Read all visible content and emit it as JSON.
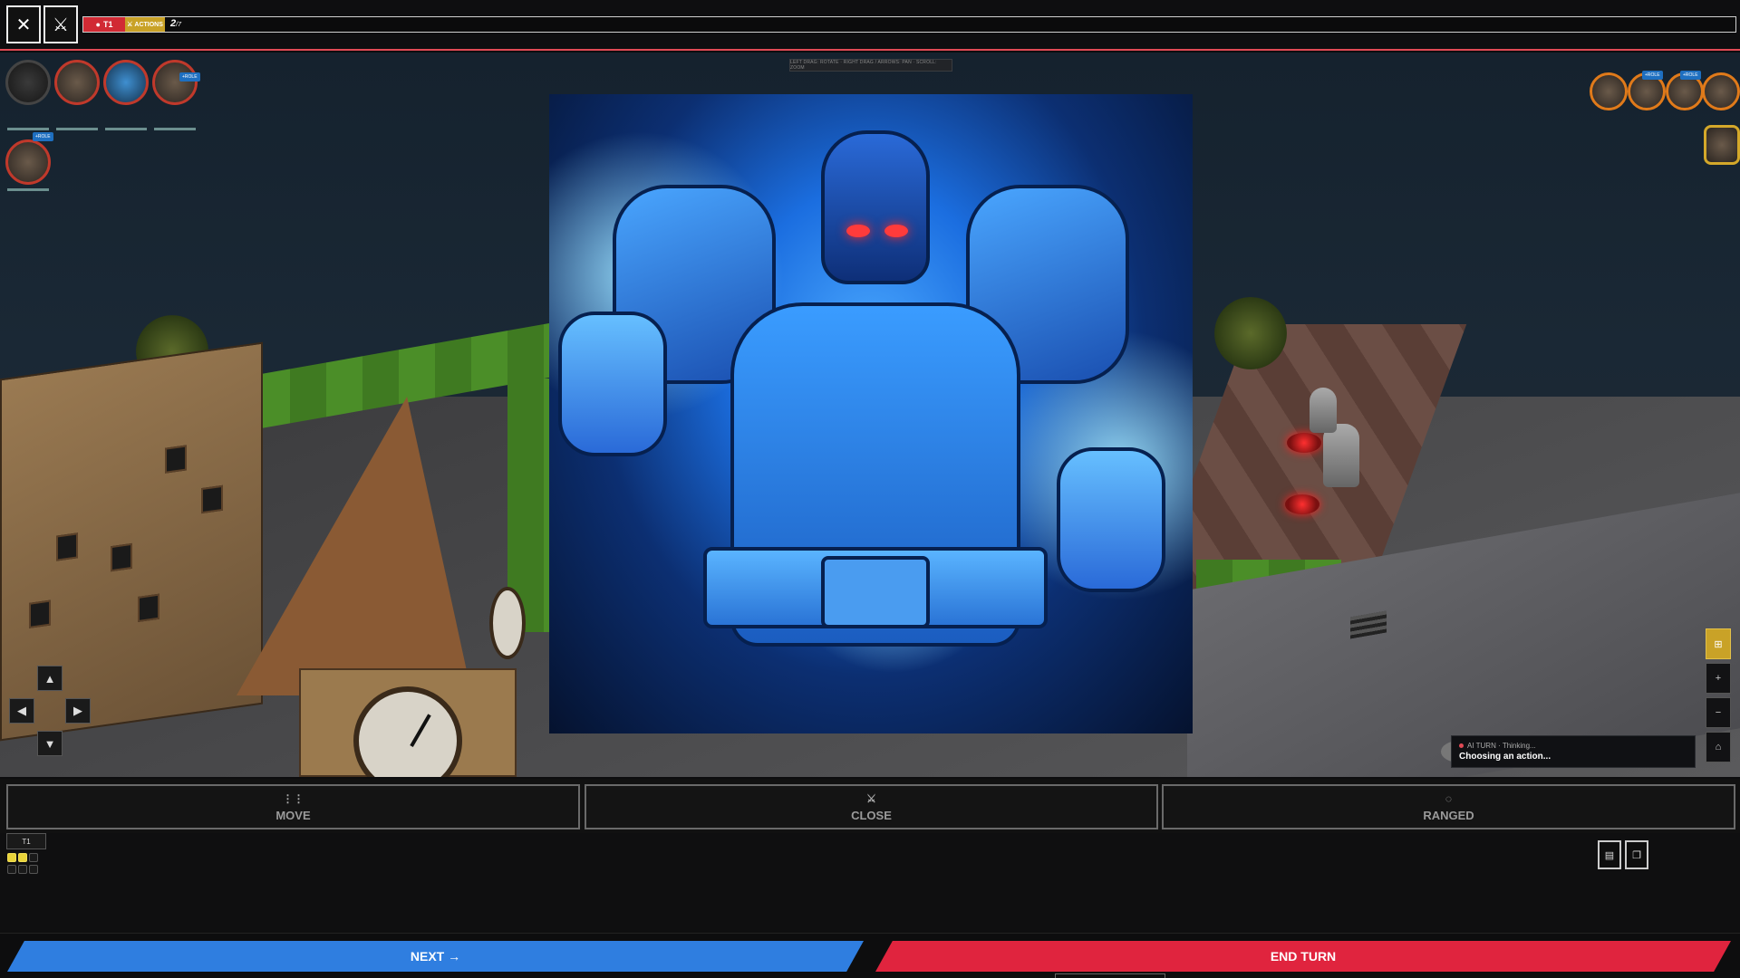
{
  "topbar": {
    "close_icon": "close-icon",
    "swords_icon": "swords-icon",
    "team_label": "T1",
    "actions_label": "ACTIONS",
    "round_number": "2",
    "round_total": "/7",
    "accent_color": "#e04a55"
  },
  "hint": "LEFT DRAG: ROTATE · RIGHT DRAG / ARROWS: PAN · SCROLL: ZOOM",
  "tokens": {
    "tag_label": "+ROLE"
  },
  "card": {
    "subject": "blue armored mech hero"
  },
  "camera_nav": {
    "up": "▲",
    "left": "◀",
    "right": "▶",
    "down": "▼"
  },
  "ai_panel": {
    "status": "AI TURN · Thinking...",
    "message": "Choosing an action..."
  },
  "actions": {
    "move": {
      "label": "MOVE",
      "icon": "footprints-icon"
    },
    "close": {
      "label": "CLOSE",
      "icon": "swords-icon"
    },
    "ranged": {
      "label": "RANGED",
      "icon": "crosshair-icon"
    }
  },
  "turn": {
    "tag": "T1"
  },
  "footer": {
    "next_label": "NEXT →",
    "end_label": "END TURN",
    "next_color": "#2f7ee0",
    "end_color": "#e0243e"
  }
}
